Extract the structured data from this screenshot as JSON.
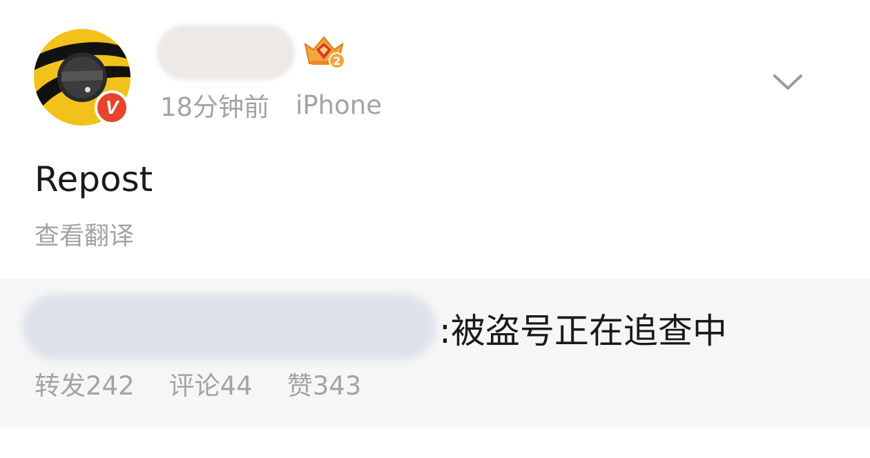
{
  "post": {
    "time": "18分钟前",
    "source": "iPhone",
    "text": "Repost",
    "translate_label": "查看翻译",
    "verified_mark": "V",
    "vip_level": "2"
  },
  "repost": {
    "original_text": ":被盗号正在追查中",
    "stats": {
      "reposts": "转发242",
      "comments": "评论44",
      "likes": "赞343"
    }
  },
  "colors": {
    "accent_red": "#e6452b",
    "gold": "#f2c21a",
    "meta_gray": "#a3a3a3",
    "repost_bg": "#f6f6f6"
  },
  "icons": {
    "menu": "chevron-down-icon",
    "vip": "crown-badge-icon",
    "verified": "verified-v-icon"
  }
}
